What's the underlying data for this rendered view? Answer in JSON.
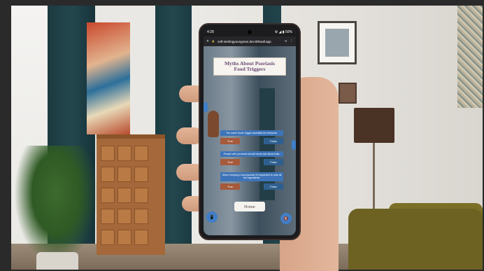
{
  "phone": {
    "status_time": "4:28",
    "status_icons": "⚙ ◢ ▮ 50%",
    "url": "soft-sterlingyoungman.dev.8thwall.app",
    "quiz": {
      "title_line1": "Myths About Psoriasis",
      "title_line2": "Food Triggers",
      "questions": [
        {
          "text": "The same foods trigger psoriasis for everyone.",
          "true_label": "True",
          "false_label": "False"
        },
        {
          "text": "People with psoriasis should never eat citrus fruits.",
          "true_label": "True",
          "false_label": "False"
        },
        {
          "text": "When keeping a food journal, it's important to note all the ingredients.",
          "true_label": "True",
          "false_label": "False"
        }
      ],
      "home_label": "Home"
    },
    "icons": {
      "close": "✕",
      "lock": "🔒",
      "share": "⋖",
      "menu": "⋮",
      "left_icon": "📱",
      "sound_icon": "🔇"
    }
  }
}
